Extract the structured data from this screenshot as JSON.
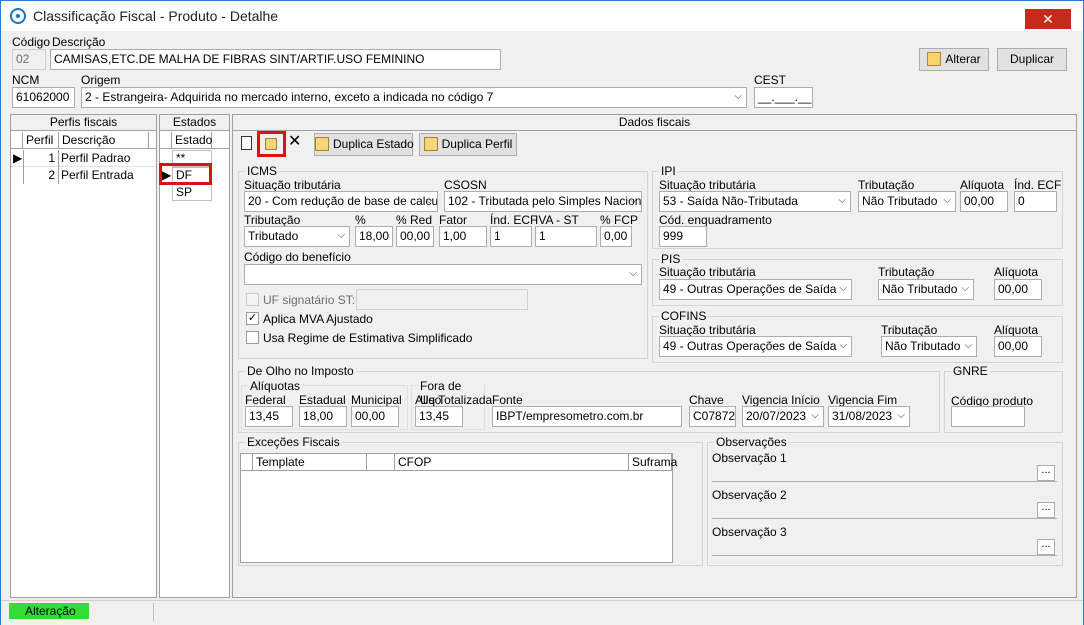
{
  "window": {
    "title": "Classificação Fiscal - Produto - Detalhe",
    "close_glyph": "✕"
  },
  "header": {
    "codigo_label": "Código",
    "codigo_value": "02",
    "descricao_label": "Descrição",
    "descricao_value": "CAMISAS,ETC.DE MALHA DE FIBRAS SINT/ARTIF.USO FEMININO",
    "ncm_label": "NCM",
    "ncm_value": "61062000",
    "origem_label": "Origem",
    "origem_value": "2 - Estrangeira- Adquirida no mercado interno, exceto a indicada no código 7",
    "cest_label": "CEST",
    "cest_value": "__.___.__",
    "alterar_label": "Alterar",
    "duplicar_label": "Duplicar"
  },
  "perfis": {
    "title": "Perfis fiscais",
    "col_perfil": "Perfil",
    "col_descricao": "Descrição",
    "rows": [
      {
        "perfil": "1",
        "descricao": "Perfil Padrao"
      },
      {
        "perfil": "2",
        "descricao": "Perfil Entrada"
      }
    ]
  },
  "estados": {
    "title": "Estados",
    "col_estado": "Estado",
    "rows": [
      "**",
      "DF",
      "SP"
    ]
  },
  "dados": {
    "title": "Dados fiscais",
    "duplica_estado_label": "Duplica Estado",
    "duplica_perfil_label": "Duplica Perfil",
    "icms": {
      "title": "ICMS",
      "situacao_label": "Situação tributária",
      "situacao_value": "20 - Com redução de base de calcul",
      "csosn_label": "CSOSN",
      "csosn_value": "102 - Tributada pelo Simples Naciona",
      "tributacao_label": "Tributação",
      "tributacao_value": "Tributado",
      "pct_label": "%",
      "pct_value": "18,00",
      "pct_red_label": "% Red",
      "pct_red_value": "00,00",
      "fator_label": "Fator",
      "fator_value": "1,00",
      "ind_ecf_label": "Índ. ECF",
      "ind_ecf_value": "1",
      "iva_st_label": "IVA - ST",
      "iva_st_value": "1",
      "pct_fcp_label": "% FCP",
      "pct_fcp_value": "0,00",
      "beneficio_label": "Código do benefício",
      "beneficio_value": "",
      "uf_signatario_label": "UF signatário ST:",
      "aplica_mva_label": "Aplica MVA Ajustado",
      "aplica_mva_checked": "✓",
      "regime_label": "Usa Regime de Estimativa Simplificado"
    },
    "ipi": {
      "title": "IPI",
      "situacao_label": "Situação tributária",
      "situacao_value": "53 - Saída Não-Tributada",
      "tributacao_label": "Tributação",
      "tributacao_value": "Não Tributado",
      "aliquota_label": "Alíquota",
      "aliquota_value": "00,00",
      "ind_ecf_label": "Índ. ECF",
      "ind_ecf_value": "0",
      "enquadramento_label": "Cód. enquadramento",
      "enquadramento_value": "999"
    },
    "pis": {
      "title": "PIS",
      "situacao_label": "Situação tributária",
      "situacao_value": "49 - Outras Operações de Saída",
      "tributacao_label": "Tributação",
      "tributacao_value": "Não Tributado",
      "aliquota_label": "Alíquota",
      "aliquota_value": "00,00"
    },
    "cofins": {
      "title": "COFINS",
      "situacao_label": "Situação tributária",
      "situacao_value": "49 - Outras Operações de Saída",
      "tributacao_label": "Tributação",
      "tributacao_value": "Não Tributado",
      "aliquota_label": "Alíquota",
      "aliquota_value": "00,00"
    },
    "olho": {
      "title": "De Olho no Imposto",
      "aliquotas_title": "Alíquotas",
      "federal_label": "Federal",
      "federal_value": "13,45",
      "estadual_label": "Estadual",
      "estadual_value": "18,00",
      "municipal_label": "Municipal",
      "municipal_value": "00,00",
      "fora_title": "Fora de Uso",
      "aliq_total_label": "Aliq Totalizada",
      "aliq_total_value": "13,45",
      "fonte_label": "Fonte",
      "fonte_value": "IBPT/empresometro.com.br",
      "chave_label": "Chave",
      "chave_value": "C07872",
      "vig_inicio_label": "Vigencia Início",
      "vig_inicio_value": "20/07/2023",
      "vig_fim_label": "Vigencia Fim",
      "vig_fim_value": "31/08/2023"
    },
    "gnre": {
      "title": "GNRE",
      "codigo_label": "Código produto",
      "codigo_value": ""
    },
    "excecoes": {
      "title": "Exceções Fiscais",
      "col_template": "Template",
      "col_cfop": "CFOP",
      "col_suframa": "Suframa"
    },
    "observacoes": {
      "title": "Observações",
      "obs1_label": "Observação 1",
      "obs2_label": "Observação 2",
      "obs3_label": "Observação 3",
      "ellipsis": "..."
    }
  },
  "status": {
    "mode": "Alteração"
  },
  "colors": {
    "highlight": "#e01010",
    "status_green": "#33dd33",
    "close_red": "#c42b1c"
  }
}
